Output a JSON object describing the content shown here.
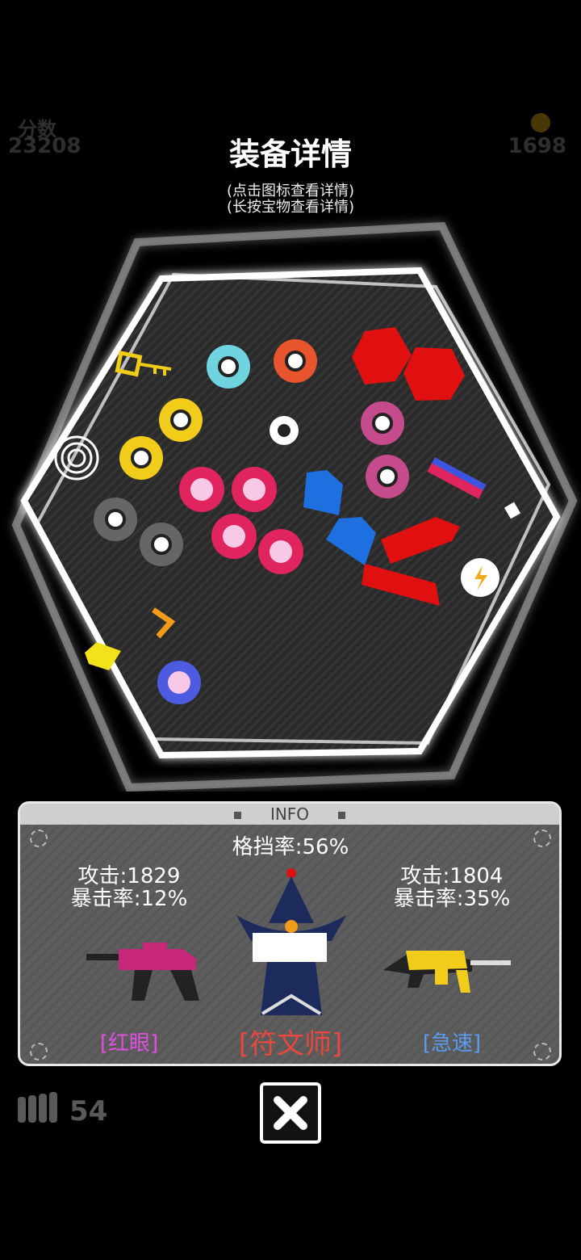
{
  "hud": {
    "score_label": "分数",
    "score_value": "23208",
    "coin_value": "1698",
    "ammo_count": "54"
  },
  "header": {
    "title": "装备详情",
    "hint_tap": "(点击图标查看详情)",
    "hint_hold": "(长按宝物查看详情)"
  },
  "info": {
    "panel_title": "INFO",
    "block_rate": "格挡率:56%",
    "left_weapon": {
      "attack": "攻击:1829",
      "crit": "暴击率:12%",
      "name": "[红眼]",
      "color": "#e04fe0"
    },
    "right_weapon": {
      "attack": "攻击:1804",
      "crit": "暴击率:35%",
      "name": "[急速]",
      "color": "#5b9bf0"
    },
    "character_name": "[符文师]",
    "character_color": "#e8483e"
  },
  "colors": {
    "accent": "#ffffff",
    "pink": "#e0245e",
    "red": "#e01010",
    "blue": "#1e6fe0",
    "yellow": "#f2cc1a"
  }
}
